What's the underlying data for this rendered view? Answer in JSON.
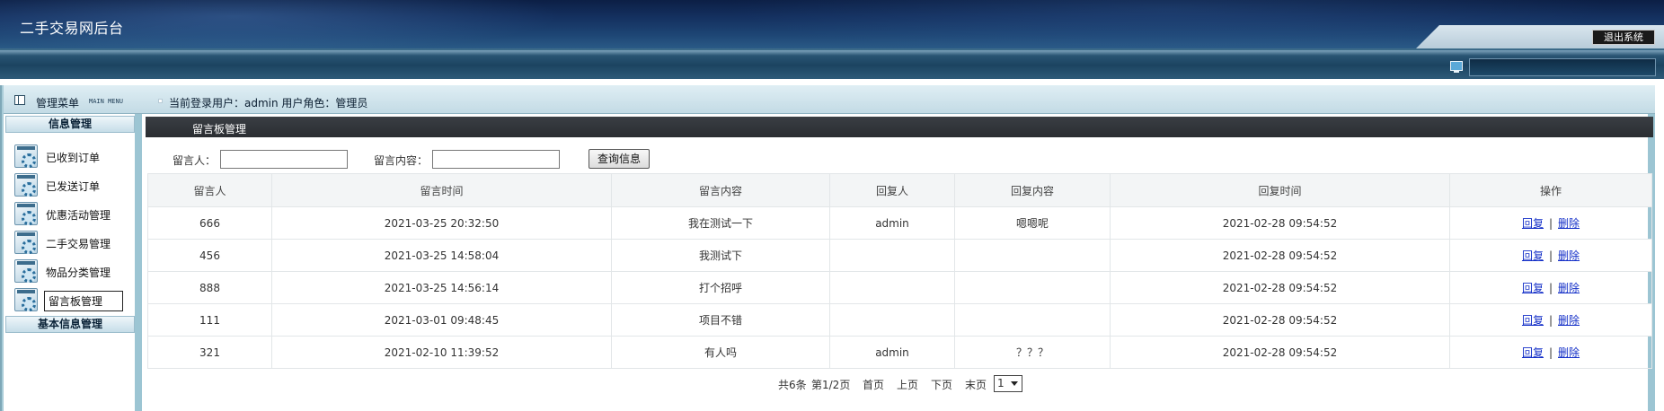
{
  "header": {
    "site_title": "二手交易网后台",
    "logout_label": "退出系统"
  },
  "sidebar": {
    "title": "管理菜单",
    "subtitle": "MAIN MENU",
    "section_info": "信息管理",
    "items": [
      {
        "label": "已收到订单",
        "icon": "gear-icon"
      },
      {
        "label": "已发送订单",
        "icon": "gear-icon"
      },
      {
        "label": "优惠活动管理",
        "icon": "gear-icon"
      },
      {
        "label": "二手交易管理",
        "icon": "gear-icon"
      },
      {
        "label": "物品分类管理",
        "icon": "gear-icon"
      },
      {
        "label": "留言板管理",
        "icon": "gear-icon"
      }
    ],
    "section_basic": "基本信息管理"
  },
  "userline": {
    "text": "当前登录用户：admin  用户角色：管理员"
  },
  "content": {
    "title": "留言板管理",
    "search": {
      "author_label": "留言人：",
      "author_value": "",
      "content_label": "留言内容：",
      "content_value": "",
      "button_label": "查询信息"
    },
    "table": {
      "headers": [
        "留言人",
        "留言时间",
        "留言内容",
        "回复人",
        "回复内容",
        "回复时间",
        "操作"
      ],
      "rows": [
        {
          "author": "666",
          "time": "2021-03-25 20:32:50",
          "content": "我在测试一下",
          "replier": "admin",
          "reply": "嗯嗯呢",
          "reply_time": "2021-02-28 09:54:52"
        },
        {
          "author": "456",
          "time": "2021-03-25 14:58:04",
          "content": "我测试下",
          "replier": "",
          "reply": "",
          "reply_time": "2021-02-28 09:54:52"
        },
        {
          "author": "888",
          "time": "2021-03-25 14:56:14",
          "content": "打个招呼",
          "replier": "",
          "reply": "",
          "reply_time": "2021-02-28 09:54:52"
        },
        {
          "author": "111",
          "time": "2021-03-01 09:48:45",
          "content": "项目不错",
          "replier": "",
          "reply": "",
          "reply_time": "2021-02-28 09:54:52"
        },
        {
          "author": "321",
          "time": "2021-02-10 11:39:52",
          "content": "有人吗",
          "replier": "admin",
          "reply": "？？？",
          "reply_time": "2021-02-28 09:54:52"
        }
      ],
      "action_reply": "回复",
      "action_sep": "|",
      "action_delete": "删除"
    },
    "pager": {
      "total": "共6条",
      "page": "第1/2页",
      "first": "首页",
      "prev": "上页",
      "next": "下页",
      "last": "末页",
      "selected": "1"
    }
  }
}
